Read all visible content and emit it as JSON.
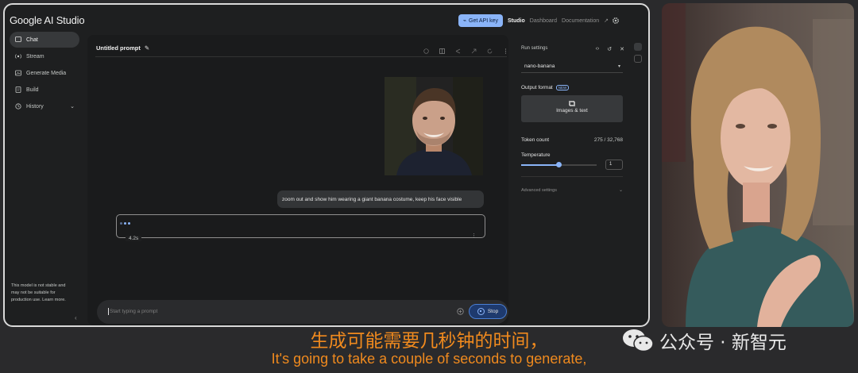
{
  "app": {
    "brand": "Google AI Studio",
    "api_key_button": "Get API key",
    "nav_studio": "Studio",
    "nav_dashboard": "Dashboard",
    "nav_documentation": "Documentation"
  },
  "sidebar": {
    "items": [
      {
        "label": "Chat",
        "icon": "chat-icon",
        "active": true
      },
      {
        "label": "Stream",
        "icon": "stream-icon",
        "active": false
      },
      {
        "label": "Generate Media",
        "icon": "media-icon",
        "active": false
      },
      {
        "label": "Build",
        "icon": "build-icon",
        "active": false
      },
      {
        "label": "History",
        "icon": "history-icon",
        "active": false
      }
    ],
    "note": "This model is not stable and may not be suitable for production use. Learn more."
  },
  "main": {
    "prompt_title": "Untitled prompt",
    "user_message": "zoom out and show him wearing a giant banana costume, keep his face visible",
    "timer": "4.2s",
    "input_placeholder": "Start typing a prompt",
    "stop_label": "Stop"
  },
  "settings": {
    "title": "Run settings",
    "model": "nano-banana",
    "output_format_label": "Output format",
    "new_badge": "NEW",
    "output_format_value": "Images & text",
    "token_count_label": "Token count",
    "token_count_value": "275 / 32,768",
    "temperature_label": "Temperature",
    "temperature_value": "1",
    "temperature_fraction": 0.5,
    "advanced_label": "Advanced settings"
  },
  "subtitles": {
    "chinese": "生成可能需要几秒钟的时间，",
    "english": "It's going to take a couple of seconds to generate,"
  },
  "watermark": {
    "text": "公众号 · 新智元"
  },
  "colors": {
    "accent": "#8ab4f8",
    "subtitle": "#f08a1e"
  }
}
